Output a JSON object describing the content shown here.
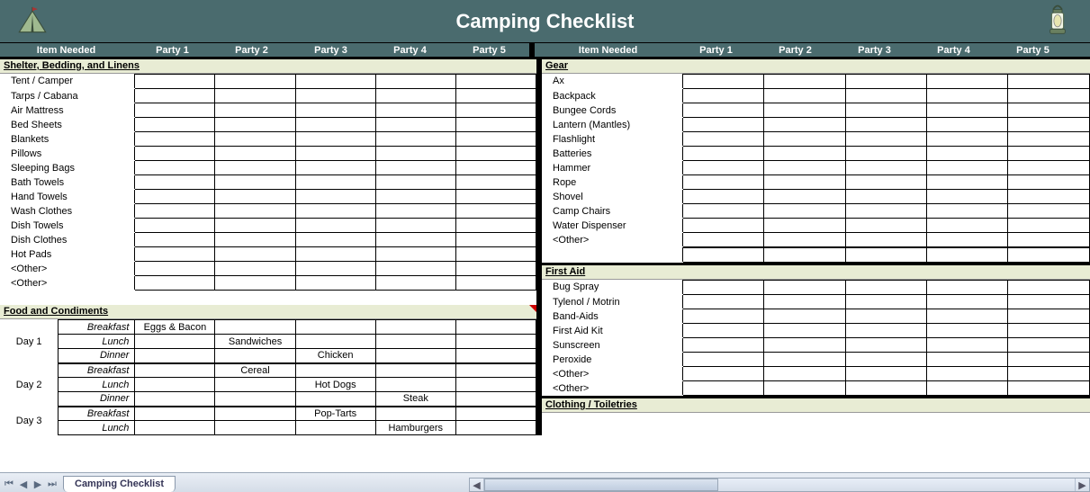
{
  "title": "Camping Checklist",
  "sheet_tab": "Camping Checklist",
  "columns_left": {
    "item": "Item Needed",
    "parties": [
      "Party 1",
      "Party 2",
      "Party 3",
      "Party 4",
      "Party 5"
    ]
  },
  "columns_right": {
    "item": "Item Needed",
    "parties": [
      "Party 1",
      "Party 2",
      "Party 3",
      "Party 4",
      "Party 5"
    ]
  },
  "left_sections": [
    {
      "name": "Shelter, Bedding, and Linens",
      "items": [
        "Tent / Camper",
        "Tarps / Cabana",
        "Air Mattress",
        "Bed Sheets",
        "Blankets",
        "Pillows",
        "Sleeping Bags",
        "Bath Towels",
        "Hand Towels",
        "Wash Clothes",
        "Dish Towels",
        "Dish Clothes",
        "Hot Pads",
        "<Other>",
        "<Other>"
      ]
    }
  ],
  "food_section": {
    "name": "Food and Condiments",
    "meals": [
      "Breakfast",
      "Lunch",
      "Dinner"
    ],
    "days": [
      {
        "label": "Day 1",
        "rows": [
          {
            "meal": "Breakfast",
            "cells": [
              "Eggs & Bacon",
              "",
              "",
              "",
              ""
            ]
          },
          {
            "meal": "Lunch",
            "cells": [
              "",
              "Sandwiches",
              "",
              "",
              ""
            ]
          },
          {
            "meal": "Dinner",
            "cells": [
              "",
              "",
              "Chicken",
              "",
              ""
            ]
          }
        ]
      },
      {
        "label": "Day 2",
        "rows": [
          {
            "meal": "Breakfast",
            "cells": [
              "",
              "Cereal",
              "",
              "",
              ""
            ]
          },
          {
            "meal": "Lunch",
            "cells": [
              "",
              "",
              "Hot Dogs",
              "",
              ""
            ]
          },
          {
            "meal": "Dinner",
            "cells": [
              "",
              "",
              "",
              "Steak",
              ""
            ]
          }
        ]
      },
      {
        "label": "Day 3",
        "rows": [
          {
            "meal": "Breakfast",
            "cells": [
              "",
              "",
              "Pop-Tarts",
              "",
              ""
            ]
          },
          {
            "meal": "Lunch",
            "cells": [
              "",
              "",
              "",
              "Hamburgers",
              ""
            ]
          }
        ]
      }
    ]
  },
  "right_sections": [
    {
      "name": "Gear",
      "items": [
        "Ax",
        "Backpack",
        "Bungee Cords",
        "Lantern (Mantles)",
        "Flashlight",
        "Batteries",
        "Hammer",
        "Rope",
        "Shovel",
        "Camp Chairs",
        "Water Dispenser",
        "<Other>"
      ]
    },
    {
      "name": "First Aid",
      "items": [
        "Bug Spray",
        "Tylenol / Motrin",
        "Band-Aids",
        "First Aid Kit",
        "Sunscreen",
        "Peroxide",
        "<Other>",
        "<Other>"
      ]
    },
    {
      "name": "Clothing / Toiletries",
      "items": []
    }
  ]
}
